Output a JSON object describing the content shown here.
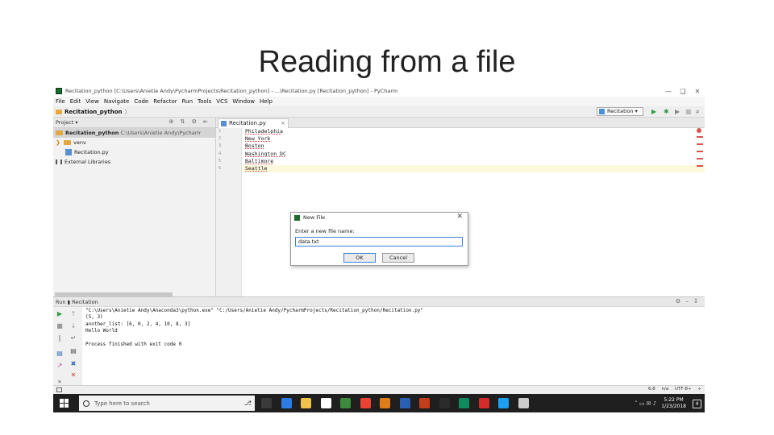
{
  "slide": {
    "title": "Reading from a file"
  },
  "window": {
    "title": "Recitation_python [C:\\Users\\Anietie Andy\\PycharmProjects\\Recitation_python] - ...\\Recitation.py [Recitation_python] - PyCharm",
    "minimize": "—",
    "maximize": "❑",
    "close": "✕"
  },
  "menu": [
    "File",
    "Edit",
    "View",
    "Navigate",
    "Code",
    "Refactor",
    "Run",
    "Tools",
    "VCS",
    "Window",
    "Help"
  ],
  "navbar": {
    "crumb": "Recitation_python",
    "sep": "〉",
    "run_config": "Recitation ▾",
    "run_icon": "▶",
    "debug_icon": "✱",
    "coverage_icon": "▶",
    "stop_icon": "■",
    "search_icon": "⌕"
  },
  "project": {
    "header": "Project ▾",
    "controls": "⊕ ⇅ ⚙ ⇤",
    "root_name": "Recitation_python",
    "root_path": "C:\\Users\\Anietie Andy\\PycharmProjects\\Recitation_python",
    "venv": "venv",
    "file": "Recitation.py",
    "libs": "External Libraries",
    "arrow": "❯"
  },
  "editor": {
    "tab_label": "Recitation.py",
    "tab_close": "×",
    "line_numbers": [
      "1",
      "2",
      "3",
      "4",
      "5",
      "6"
    ],
    "lines": [
      "Philadelphia",
      "New York",
      "Boston",
      "Washington DC",
      "Baltimore",
      "Seattle"
    ]
  },
  "dialog": {
    "title": "New File",
    "close": "✕",
    "prompt": "Enter a new file name:",
    "value": "data.txt",
    "ok": "OK",
    "cancel": "Cancel"
  },
  "run": {
    "header": "Run ▮ Recitation",
    "controls": "⚙ – ↧",
    "output": [
      "\"C:\\Users\\Anietie Andy\\Anaconda3\\python.exe\" \"C:/Users/Anietie Andy/PycharmProjects/Recitation_python/Recitation.py\"",
      "(5, 3)",
      "another_list: [6, 0, 2, 4, 10, 8, 3]",
      "Hello World",
      "",
      "Process finished with exit code 0"
    ],
    "tools": {
      "rerun": "▶",
      "up": "↑",
      "stop": "■",
      "down": "↓",
      "pause": "‖",
      "wrap": "↵",
      "print": "▤",
      "pin": "↗",
      "trash": "✖",
      "close": "✕",
      "more": "»"
    }
  },
  "status": {
    "items": "6:8 n/a UTF-8÷ ÷"
  },
  "taskbar": {
    "search_placeholder": "Type here to search",
    "mic": "⎇",
    "tray": "˄ ▭ ✉ ♪",
    "time": "5:22 PM",
    "date": "1/23/2018",
    "notifications": "4",
    "app_colors": [
      "#3a3a3a",
      "#2d7be5",
      "#f0c24b",
      "#ffffff",
      "#3c8a3c",
      "#ea4335",
      "#e07c1a",
      "#2b5fb3",
      "#c43e1c",
      "#2b2b2b",
      "#0e8a5f",
      "#d42b2b",
      "#1da0f2",
      "#cccccc"
    ]
  }
}
